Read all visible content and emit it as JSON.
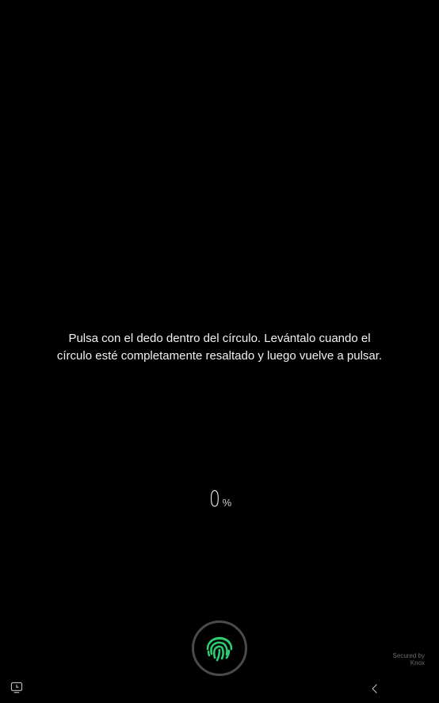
{
  "instruction": {
    "line1": "Pulsa con el dedo dentro del círculo. Levántalo cuando el",
    "line2": "círculo esté completamente resaltado y luego vuelve a pulsar."
  },
  "progress": {
    "value": "0",
    "unit": "%"
  },
  "sensor": {
    "icon": "fingerprint-icon",
    "color": "#2ecc71"
  },
  "knox": {
    "line1": "Secured by",
    "line2": "Knox"
  },
  "navbar": {
    "left_icon": "screen-clock-icon",
    "back_icon": "back-chevron-icon"
  },
  "colors": {
    "background": "#000000",
    "text": "#f2f2f2",
    "sensor_ring": "#4a4a4a",
    "fingerprint": "#2ecc71"
  }
}
